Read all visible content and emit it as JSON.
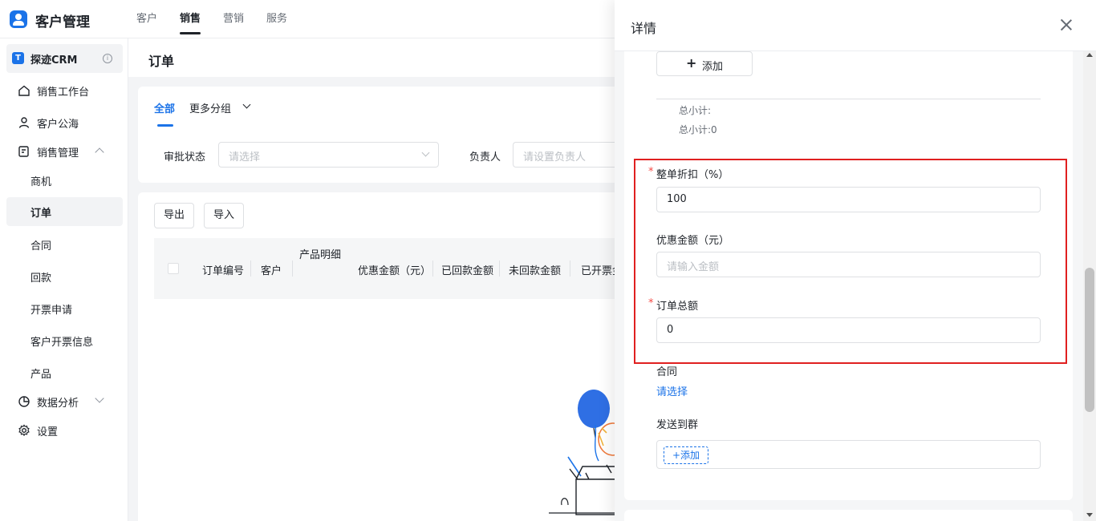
{
  "header": {
    "app_title": "客户管理",
    "nav": [
      {
        "label": "客户"
      },
      {
        "label": "销售",
        "active": true
      },
      {
        "label": "营销"
      },
      {
        "label": "服务"
      }
    ]
  },
  "sidebar": {
    "workspace": {
      "icon_letter": "T",
      "label": "探迹CRM"
    },
    "items": [
      {
        "label": "销售工作台",
        "icon": "home-icon"
      },
      {
        "label": "客户公海",
        "icon": "user-icon"
      },
      {
        "label": "销售管理",
        "icon": "edit-icon",
        "expanded": true
      },
      {
        "label": "商机"
      },
      {
        "label": "订单",
        "active": true
      },
      {
        "label": "合同"
      },
      {
        "label": "回款"
      },
      {
        "label": "开票申请"
      },
      {
        "label": "客户开票信息"
      },
      {
        "label": "产品"
      },
      {
        "label": "数据分析",
        "icon": "pie-chart-icon",
        "expanded": false
      },
      {
        "label": "设置",
        "icon": "gear-icon"
      }
    ]
  },
  "main": {
    "page_title": "订单",
    "tabs": {
      "all": "全部",
      "more": "更多分组"
    },
    "filters": {
      "approval_label": "审批状态",
      "approval_placeholder": "请选择",
      "owner_label": "负责人",
      "owner_placeholder": "请设置负责人"
    },
    "actions": {
      "export": "导出",
      "import": "导入"
    },
    "table": {
      "group_header": "产品明细",
      "columns": [
        "订单编号",
        "客户",
        "优惠金额（元）",
        "已回款金额",
        "未回款金额",
        "已开票金"
      ]
    }
  },
  "drawer": {
    "title": "详情",
    "add_button": "添加",
    "subtotal_1": "总小计:",
    "subtotal_2": "总小计:0",
    "discount_label": "整单折扣（%）",
    "discount_value": "100",
    "coupon_label": "优惠金额（元）",
    "coupon_placeholder": "请输入金额",
    "total_label": "订单总额",
    "total_value": "0",
    "contract_label": "合同",
    "contract_select": "请选择",
    "send_group_label": "发送到群",
    "send_group_add": "+添加"
  },
  "colors": {
    "accent": "#1b73e8",
    "required": "#f54a45",
    "highlight_box": "#e02020"
  }
}
